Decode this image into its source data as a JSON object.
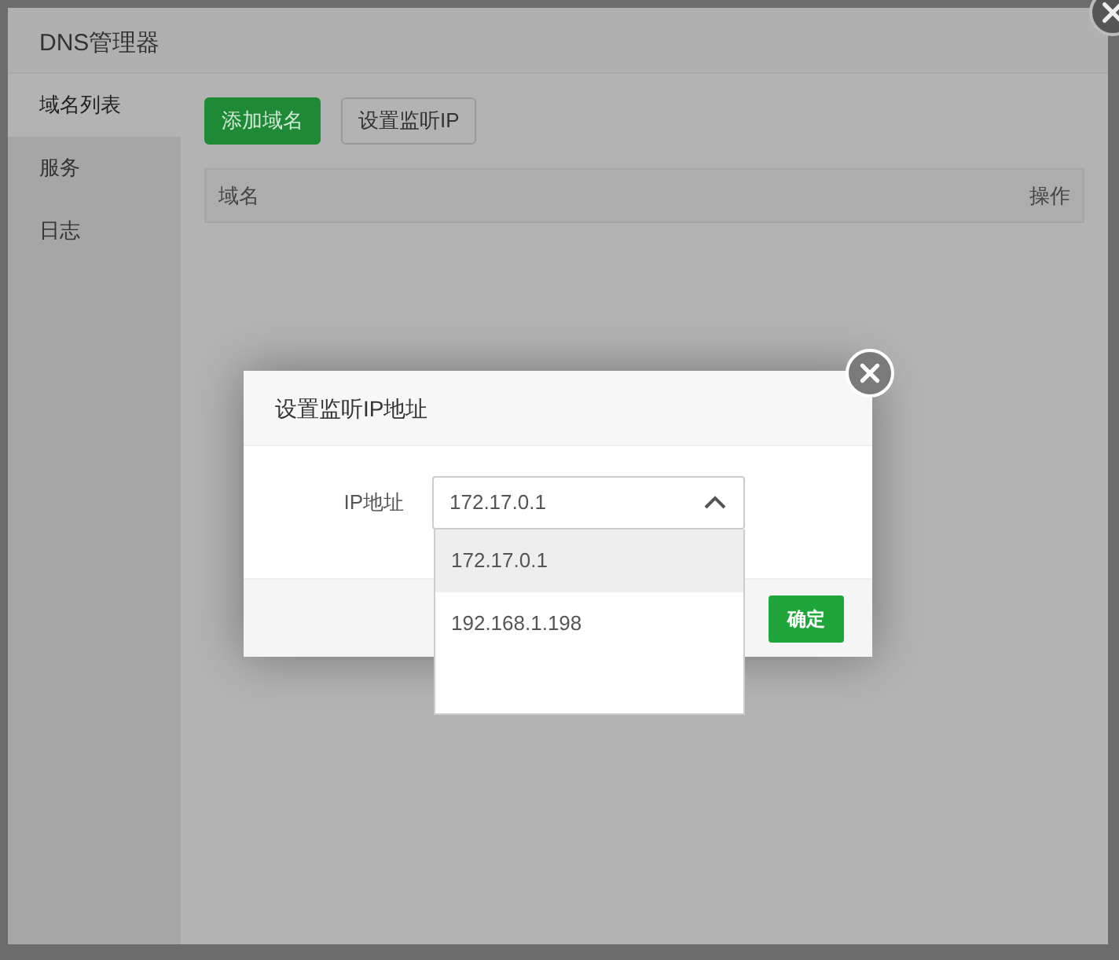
{
  "window": {
    "title": "DNS管理器"
  },
  "sidebar": {
    "items": [
      {
        "label": "域名列表",
        "selected": true
      },
      {
        "label": "服务",
        "selected": false
      },
      {
        "label": "日志",
        "selected": false
      }
    ]
  },
  "toolbar": {
    "buttons": [
      {
        "label": "添加域名",
        "kind": "primary"
      },
      {
        "label": "设置监听IP",
        "kind": "default"
      }
    ]
  },
  "table": {
    "columns": [
      "域名",
      "操作"
    ]
  },
  "dialog": {
    "title": "设置监听IP地址",
    "field": {
      "label": "IP地址",
      "value": "172.17.0.1",
      "expanded": true,
      "options": [
        {
          "label": "172.17.0.1",
          "selected": true
        },
        {
          "label": "192.168.1.198",
          "selected": false
        }
      ]
    },
    "buttons": [
      {
        "label": "确定",
        "kind": "primary"
      }
    ]
  }
}
